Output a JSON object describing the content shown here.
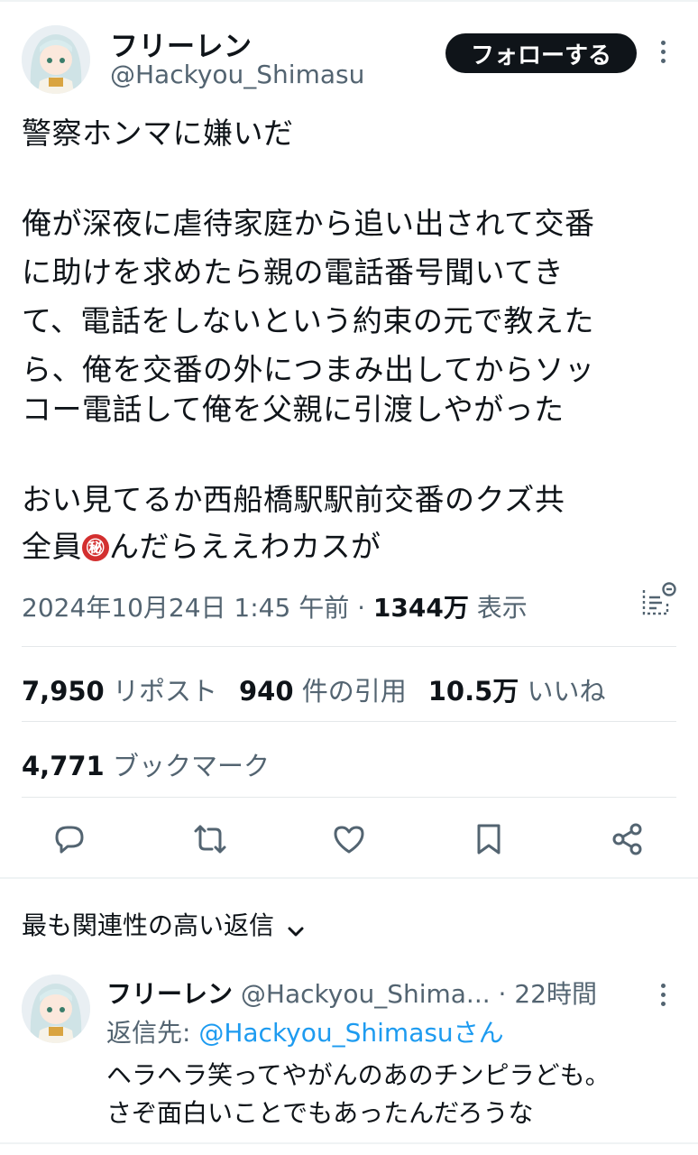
{
  "tweet": {
    "author_name": "フリーレン",
    "author_handle": "@Hackyou_Shimasu",
    "follow_label": "フォローする",
    "lines": [
      "警察ホンマに嫌いだ",
      "",
      "俺が深夜に虐待家庭から追い出されて交番",
      "に助けを求めたら親の電話番号聞いてき",
      "て、電話をしないという約束の元で教えた",
      "ら、俺を交番の外につまみ出してからソッ",
      "コー電話して俺を父親に引渡しやがった",
      "",
      "おい見てるか西船橋駅駅前交番のクズ共"
    ],
    "last_line_before": "全員",
    "secret_symbol": "㊙",
    "last_line_after": "んだらええわカスが",
    "timestamp": "2024年10月24日 1:45 午前",
    "separator": " · ",
    "views_count": "1344万",
    "views_label": " 表示"
  },
  "stats": {
    "reposts_count": "7,950",
    "reposts_label": "リポスト",
    "quotes_count": "940",
    "quotes_label": "件の引用",
    "likes_count": "10.5万",
    "likes_label": "いいね",
    "bookmarks_count": "4,771",
    "bookmarks_label": "ブックマーク"
  },
  "actions": [
    "reply-icon",
    "repost-icon",
    "like-icon",
    "bookmark-icon",
    "share-icon"
  ],
  "replies_filter": {
    "label": "最も関連性の高い返信",
    "chevron": "⌄"
  },
  "reply": {
    "author_name": "フリーレン",
    "author_handle": "@Hackyou_Shima...",
    "time": "· 22時間",
    "replying_to_prefix": "返信先: ",
    "replying_to_handle": "@Hackyou_Shimasuさん",
    "lines": [
      "ヘラヘラ笑ってやがんのあのチンピラども。",
      "さぞ面白いことでもあったんだろうな"
    ]
  },
  "colors": {
    "text": "#0f1419",
    "secondary": "#536471",
    "link": "#1d9bf0",
    "button": "#0f1419"
  }
}
